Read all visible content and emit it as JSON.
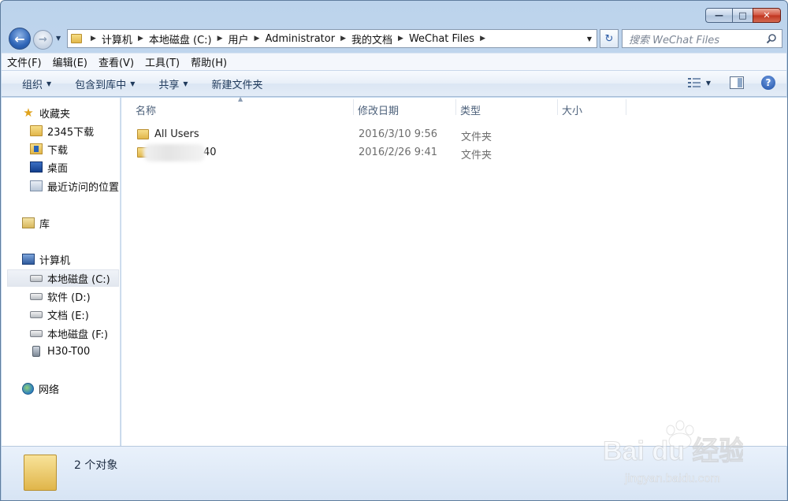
{
  "window": {
    "caption_buttons": {
      "minimize": "—",
      "maximize": "□",
      "close": "✕"
    }
  },
  "nav": {
    "back": "←",
    "forward": "→",
    "breadcrumbs": [
      "计算机",
      "本地磁盘 (C:)",
      "用户",
      "Administrator",
      "我的文档",
      "WeChat Files"
    ],
    "search_placeholder": "搜索 WeChat Files"
  },
  "menu": {
    "items": [
      "文件(F)",
      "编辑(E)",
      "查看(V)",
      "工具(T)",
      "帮助(H)"
    ]
  },
  "command_bar": {
    "organize": "组织",
    "include_in_library": "包含到库中",
    "share": "共享",
    "new_folder": "新建文件夹",
    "help": "?"
  },
  "sidebar": {
    "favorites": {
      "label": "收藏夹",
      "items": [
        "2345下载",
        "下载",
        "桌面",
        "最近访问的位置"
      ]
    },
    "libraries": {
      "label": "库"
    },
    "computer": {
      "label": "计算机",
      "items": [
        "本地磁盘 (C:)",
        "软件 (D:)",
        "文档 (E:)",
        "本地磁盘 (F:)",
        "H30-T00"
      ],
      "selected_index": 0
    },
    "network": {
      "label": "网络"
    }
  },
  "columns": [
    "名称",
    "修改日期",
    "类型",
    "大小"
  ],
  "files": [
    {
      "name": "All Users",
      "modified": "2016/3/10 9:56",
      "type": "文件夹",
      "size": ""
    },
    {
      "name": "40",
      "modified": "2016/2/26 9:41",
      "type": "文件夹",
      "size": ""
    }
  ],
  "status": {
    "item_count": "2 个对象"
  },
  "watermark": {
    "brand": "Bai du 经验",
    "url": "jingyan.baidu.com"
  },
  "colors": {
    "accent": "#2f66b8",
    "selection": "#e2e7ef",
    "folder": "#e1b64a"
  }
}
